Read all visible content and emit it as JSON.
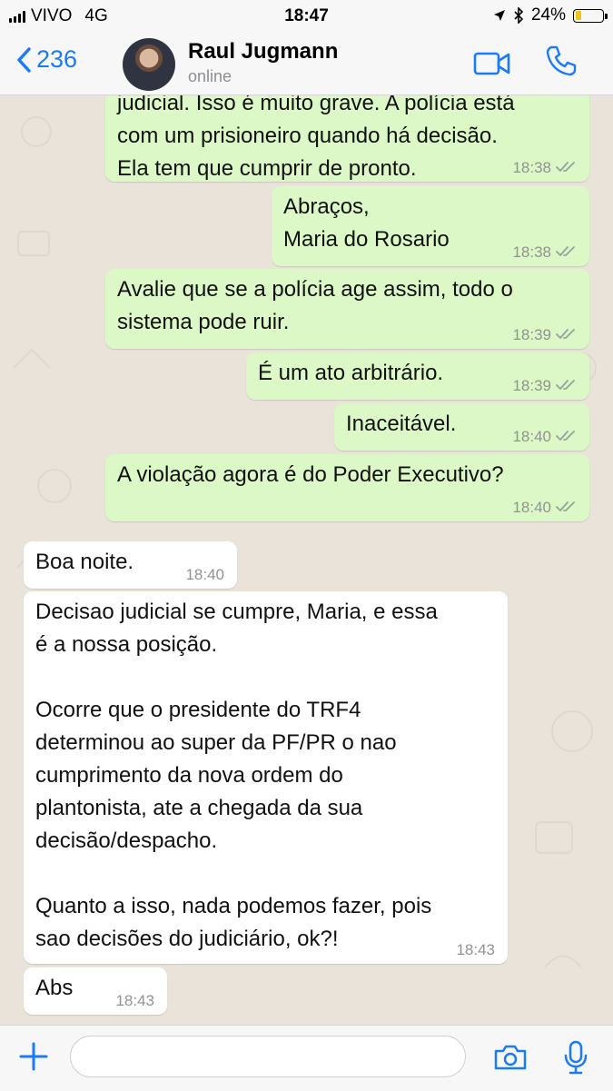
{
  "status_bar": {
    "carrier": "VIVO",
    "network": "4G",
    "time": "18:47",
    "battery": "24%",
    "battery_level": 0.24,
    "battery_color": "#f0c419"
  },
  "header": {
    "back_count": "236",
    "contact_name": "Raul Jugmann",
    "status": "online",
    "accent_color": "#1a7af8",
    "icons": [
      "chevron-left-icon",
      "video-call-icon",
      "phone-icon"
    ]
  },
  "messages": [
    {
      "direction": "out",
      "text": "judicial. Isso é muito grave. A polícia está\ncom um prisioneiro quando há decisão.\nEla tem que cumprir de pronto.",
      "time": "18:38",
      "read": true
    },
    {
      "direction": "out",
      "text": "Abraços,\nMaria do Rosario",
      "time": "18:38",
      "read": true
    },
    {
      "direction": "out",
      "text": "Avalie que se a polícia age assim, todo o\nsistema pode ruir.",
      "time": "18:39",
      "read": true
    },
    {
      "direction": "out",
      "text": "É um ato arbitrário.",
      "time": "18:39",
      "read": true
    },
    {
      "direction": "out",
      "text": "Inaceitável.",
      "time": "18:40",
      "read": true
    },
    {
      "direction": "out",
      "text": "A violação agora é do Poder Executivo?",
      "time": "18:40",
      "read": true
    },
    {
      "direction": "in",
      "text": "Boa noite.",
      "time": "18:40"
    },
    {
      "direction": "in",
      "text": "Decisao judicial se cumpre, Maria, e essa\né a nossa posição.\n\nOcorre que o presidente do TRF4\ndeterminou ao super da PF/PR o nao\ncumprimento da nova ordem do\nplantonista, ate a chegada da sua\ndecisão/despacho.\n\nQuanto a isso, nada podemos fazer, pois\nsao decisões do judiciário, ok?!",
      "time": "18:43"
    },
    {
      "direction": "in",
      "text": "Abs",
      "time": "18:43"
    }
  ],
  "input_bar": {
    "placeholder": "",
    "icons": [
      "plus-icon",
      "camera-icon",
      "microphone-icon"
    ]
  },
  "colors": {
    "outgoing_bubble": "#dcf8c6",
    "incoming_bubble": "#ffffff",
    "chat_background": "#e9e3d9"
  }
}
